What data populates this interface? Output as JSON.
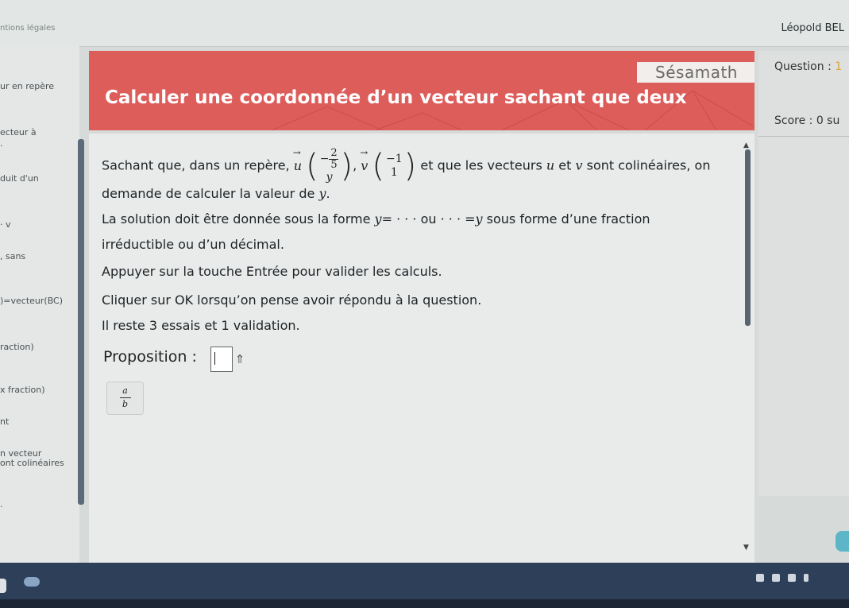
{
  "browser": {
    "legal_text": "ntions légales",
    "user_name": "Léopold BEL"
  },
  "sidebar": {
    "items": [
      "ur en repère",
      "ecteur à",
      ".",
      "duit d'un",
      "· v",
      ", sans",
      ")=vecteur(BC)",
      "raction)",
      "x fraction)",
      "nt",
      "n vecteur",
      "ont colinéaires",
      "."
    ]
  },
  "header": {
    "brand": "Sésamath",
    "title": "Calculer une coordonnée d’un vecteur sachant que deux",
    "accent_color": "#dd5d5b"
  },
  "right_panel": {
    "question_label": "Question : ",
    "question_number": "1",
    "score_label": "Score : 0 su"
  },
  "content": {
    "line1_start": "Sachant que, dans un repère,",
    "vec_u": "u",
    "u_x_sign": "−",
    "u_x_num": "2",
    "u_x_den": "5",
    "u_y": "y",
    "vec_v": "v",
    "v_x": "−1",
    "v_y": "1",
    "line1_end": "et que les vecteurs ",
    "line1_u": "u",
    "line1_et": " et ",
    "line1_v": "v",
    "line1_tail": " sont colinéaires, on",
    "line2_start": "demande de calculer la valeur de ",
    "line2_var": "y",
    "line2_end": ".",
    "line3_start": "La solution doit être donnée sous la forme ",
    "line3_m1": "y= · · ·",
    "line3_ou": " ou ",
    "line3_m2": "· · · =y",
    "line3_end": " sous forme d’une fraction",
    "line4": "irréductible ou d’un décimal.",
    "line5": "Appuyer sur la touche Entrée pour valider les calculs.",
    "line6": "Cliquer sur OK lorsqu’on pense avoir répondu à la question.",
    "line7": "Il reste 3 essais et 1 validation.",
    "proposition_label": "Proposition :",
    "answer_value": "",
    "shift_symbol": "⇑",
    "fraction_button": {
      "num": "a",
      "den": "b"
    }
  }
}
